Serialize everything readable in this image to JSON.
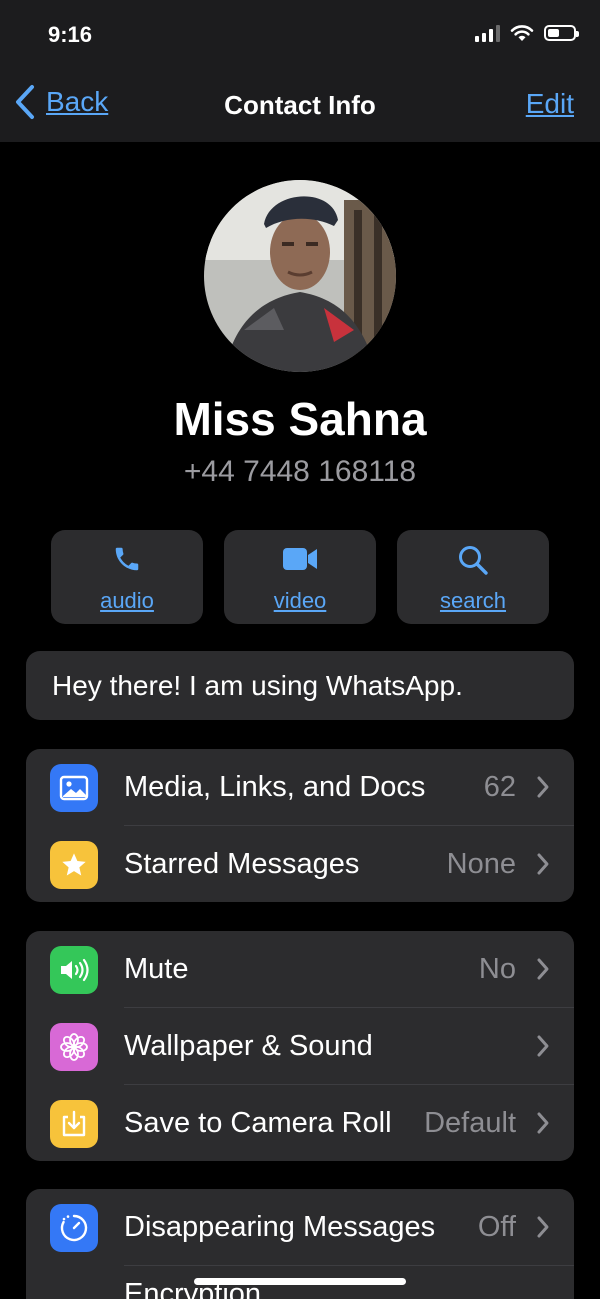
{
  "status": {
    "time": "9:16",
    "battery_level": 0.45
  },
  "nav": {
    "back_label": "Back",
    "title": "Contact Info",
    "edit_label": "Edit"
  },
  "contact": {
    "name": "Miss Sahna",
    "phone": "+44 7448 168118"
  },
  "actions": [
    {
      "label": "audio",
      "icon": "phone-icon"
    },
    {
      "label": "video",
      "icon": "video-icon"
    },
    {
      "label": "search",
      "icon": "search-icon"
    }
  ],
  "about": "Hey there! I am using WhatsApp.",
  "groups": [
    [
      {
        "label": "Media, Links, and Docs",
        "value": "62",
        "icon": "photo-icon",
        "color": "#3478f6"
      },
      {
        "label": "Starred Messages",
        "value": "None",
        "icon": "star-icon",
        "color": "#f7c33b"
      }
    ],
    [
      {
        "label": "Mute",
        "value": "No",
        "icon": "speaker-icon",
        "color": "#34c759"
      },
      {
        "label": "Wallpaper & Sound",
        "value": "",
        "icon": "flower-icon",
        "color": "#d869d6"
      },
      {
        "label": "Save to Camera Roll",
        "value": "Default",
        "icon": "download-icon",
        "color": "#f7c33b"
      }
    ],
    [
      {
        "label": "Disappearing Messages",
        "value": "Off",
        "icon": "timer-icon",
        "color": "#3478f6"
      },
      {
        "label": "Encryption",
        "value": "",
        "icon": "lock-icon",
        "color": "#3478f6"
      }
    ]
  ],
  "colors": {
    "accent": "#5aa7f7",
    "card": "#2c2c2e",
    "nav": "#1c1c1e",
    "secondary_text": "#8e8e93"
  }
}
